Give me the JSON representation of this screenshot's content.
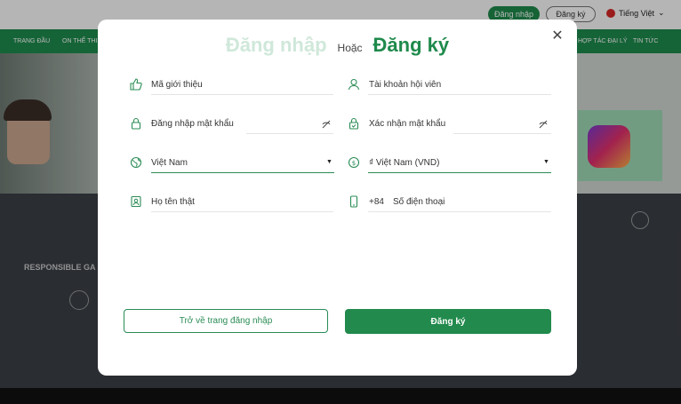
{
  "header": {
    "login_pill": "Đăng nhập",
    "register_pill": "Đăng ký",
    "language": "Tiếng Việt"
  },
  "nav": {
    "items": [
      "TRANG ĐẦU",
      "ON THỂ THI",
      "HỢP TÁC ĐẠI LÝ",
      "TIN TỨC"
    ]
  },
  "background": {
    "responsible": "RESPONSIBLE GA"
  },
  "modal": {
    "tab_login": "Đăng nhập",
    "tab_or": "Hoặc",
    "tab_register": "Đăng ký",
    "fields": {
      "referral": "Mã giới thiệu",
      "username": "Tài khoản hội viên",
      "password": "Đăng nhập mật khẩu",
      "confirm_password": "Xác nhận mật khẩu",
      "country": "Việt Nam",
      "currency": "₫ Việt Nam (VND)",
      "real_name": "Họ tên thật",
      "phone_prefix": "+84",
      "phone": "Số điện thoại"
    },
    "back_button": "Trở về trang đăng nhập",
    "register_button": "Đăng ký"
  },
  "colors": {
    "brand_green": "#1f8a4c",
    "faded_tab": "#cfe8da"
  }
}
